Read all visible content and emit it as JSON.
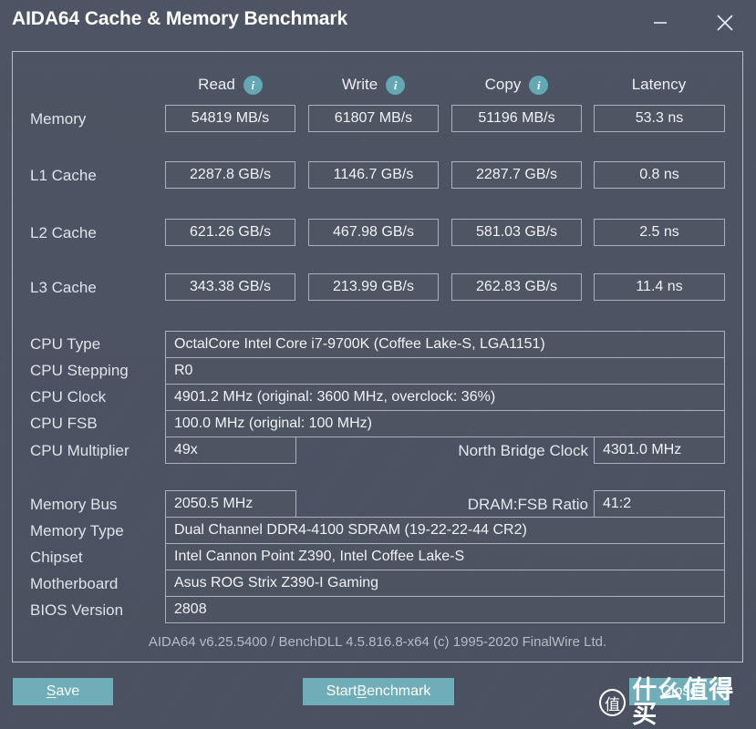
{
  "window": {
    "title": "AIDA64 Cache & Memory Benchmark",
    "minimize_icon": "minimize-icon",
    "close_icon": "close-icon"
  },
  "columns": [
    {
      "label": "Read",
      "has_info": true,
      "info_icon": "info-icon"
    },
    {
      "label": "Write",
      "has_info": true,
      "info_icon": "info-icon"
    },
    {
      "label": "Copy",
      "has_info": true,
      "info_icon": "info-icon"
    },
    {
      "label": "Latency",
      "has_info": false,
      "info_icon": ""
    }
  ],
  "benchmark_rows": [
    {
      "label": "Memory",
      "read": "54819 MB/s",
      "write": "61807 MB/s",
      "copy": "51196 MB/s",
      "latency": "53.3 ns"
    },
    {
      "label": "L1 Cache",
      "read": "2287.8 GB/s",
      "write": "1146.7 GB/s",
      "copy": "2287.7 GB/s",
      "latency": "0.8 ns"
    },
    {
      "label": "L2 Cache",
      "read": "621.26 GB/s",
      "write": "467.98 GB/s",
      "copy": "581.03 GB/s",
      "latency": "2.5 ns"
    },
    {
      "label": "L3 Cache",
      "read": "343.38 GB/s",
      "write": "213.99 GB/s",
      "copy": "262.83 GB/s",
      "latency": "11.4 ns"
    }
  ],
  "cpu_info": {
    "type_label": "CPU Type",
    "type_value": "OctalCore Intel Core i7-9700K  (Coffee Lake-S, LGA1151)",
    "stepping_label": "CPU Stepping",
    "stepping_value": "R0",
    "clock_label": "CPU Clock",
    "clock_value": "4901.2 MHz  (original: 3600 MHz, overclock: 36%)",
    "fsb_label": "CPU FSB",
    "fsb_value": "100.0 MHz  (original: 100 MHz)",
    "multiplier_label": "CPU Multiplier",
    "multiplier_value": "49x",
    "north_bridge_label": "North Bridge Clock",
    "north_bridge_value": "4301.0 MHz"
  },
  "memory_info": {
    "bus_label": "Memory Bus",
    "bus_value": "2050.5 MHz",
    "ratio_label": "DRAM:FSB Ratio",
    "ratio_value": "41:2",
    "type_label": "Memory Type",
    "type_value": "Dual Channel DDR4-4100 SDRAM  (19-22-22-44 CR2)",
    "chipset_label": "Chipset",
    "chipset_value": "Intel Cannon Point Z390, Intel Coffee Lake-S",
    "motherboard_label": "Motherboard",
    "motherboard_value": "Asus ROG Strix Z390-I Gaming",
    "bios_label": "BIOS Version",
    "bios_value": "2808"
  },
  "footer": {
    "version_text": "AIDA64 v6.25.5400 / BenchDLL 4.5.816.8-x64  (c) 1995-2020 FinalWire Ltd.",
    "save_label_pre": "",
    "save_accel": "S",
    "save_label_post": "ave",
    "start_label_pre": "Start ",
    "start_accel": "B",
    "start_label_post": "enchmark",
    "close_label": "Close"
  },
  "watermark": {
    "badge": "值",
    "text": "什么值得买"
  },
  "colors": {
    "background": "#4a5160",
    "accent_button": "#6fadb8",
    "info_icon": "#63a8b2",
    "border": "#aab1bd",
    "text": "#e8ebf0"
  }
}
